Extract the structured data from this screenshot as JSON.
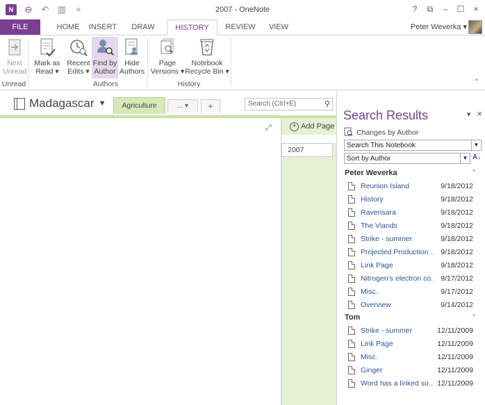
{
  "window": {
    "title": "2007 - OneNote",
    "logo": "N",
    "controls": [
      "?",
      "⧉",
      "–",
      "☐",
      "×"
    ]
  },
  "tabs": [
    {
      "label": "FILE"
    },
    {
      "label": "HOME"
    },
    {
      "label": "INSERT"
    },
    {
      "label": "DRAW"
    },
    {
      "label": "HISTORY"
    },
    {
      "label": "REVIEW"
    },
    {
      "label": "VIEW"
    }
  ],
  "user": {
    "name": "Peter Weverka ▾"
  },
  "ribbon": {
    "buttons": [
      {
        "label1": "Next",
        "label2": "Unread",
        "icon": "next-unread-icon"
      },
      {
        "label1": "Mark as",
        "label2": "Read ▾",
        "icon": "mark-as-read-icon"
      },
      {
        "label1": "Recent",
        "label2": "Edits ▾",
        "icon": "recent-edits-icon"
      },
      {
        "label1": "Find by",
        "label2": "Author",
        "icon": "find-by-author-icon"
      },
      {
        "label1": "Hide",
        "label2": "Authors",
        "icon": "hide-authors-icon"
      },
      {
        "label1": "Page",
        "label2": "Versions ▾",
        "icon": "page-versions-icon"
      },
      {
        "label1": "Notebook",
        "label2": "Recycle Bin ▾",
        "icon": "recycle-bin-icon"
      }
    ],
    "groups": [
      "Unread",
      "Authors",
      "History"
    ]
  },
  "notebook": {
    "name": "Madagascar",
    "section_tab": "Agriculture",
    "more_tab": "... ▾",
    "add_tab": "+",
    "search_placeholder": "Search (Ctrl+E)"
  },
  "pages": {
    "add_label": "Add Page",
    "items": [
      "2007"
    ]
  },
  "search_pane": {
    "title": "Search Results",
    "scope_label": "Changes by Author",
    "scope_dropdown": "Search This Notebook",
    "sort_dropdown": "Sort by Author",
    "groups": [
      {
        "author": "Peter Weverka",
        "results": [
          {
            "name": "Reunion Island",
            "date": "9/18/2012"
          },
          {
            "name": "History",
            "date": "9/18/2012"
          },
          {
            "name": "Ravensara",
            "date": "9/18/2012"
          },
          {
            "name": "The Viands",
            "date": "9/18/2012"
          },
          {
            "name": "Strike - summer",
            "date": "9/18/2012"
          },
          {
            "name": "Projected Production ...",
            "date": "9/18/2012"
          },
          {
            "name": "Link Page",
            "date": "9/18/2012"
          },
          {
            "name": "Nitrogen's electron co...",
            "date": "9/17/2012"
          },
          {
            "name": "Misc.",
            "date": "9/17/2012"
          },
          {
            "name": "Overview",
            "date": "9/14/2012"
          }
        ]
      },
      {
        "author": "Tom",
        "results": [
          {
            "name": "Strike - summer",
            "date": "12/11/2009"
          },
          {
            "name": "Link Page",
            "date": "12/11/2009"
          },
          {
            "name": "Misc.",
            "date": "12/11/2009"
          },
          {
            "name": "Ginger",
            "date": "12/11/2009"
          },
          {
            "name": "Word has a linked so...",
            "date": "12/11/2009"
          }
        ]
      }
    ]
  },
  "colors": {
    "accent": "#7a3f8f",
    "section_green": "#d7e9b9",
    "link_blue": "#2a5599"
  }
}
